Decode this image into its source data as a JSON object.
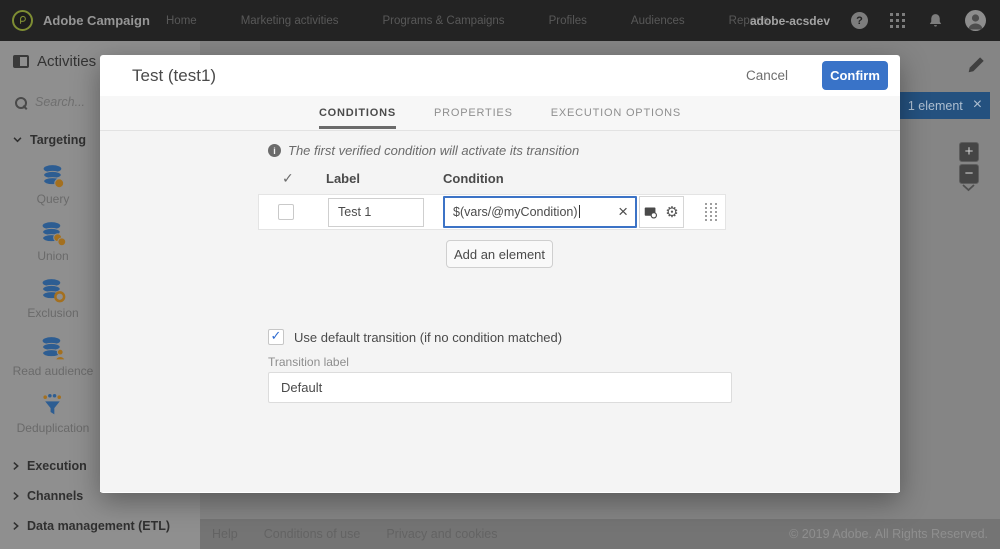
{
  "topbar": {
    "brand": "Adobe Campaign",
    "nav": [
      "Home",
      "Marketing activities",
      "Programs & Campaigns",
      "Profiles",
      "Audiences",
      "Reports"
    ],
    "account": "adobe-acsdev",
    "help_glyph": "?"
  },
  "sidebar": {
    "title": "Activities",
    "search_placeholder": "Search...",
    "targeting": {
      "label": "Targeting",
      "items": [
        "Query",
        "Union",
        "Exclusion",
        "Read audience",
        "Deduplication"
      ]
    },
    "collapsed_sections": [
      "Execution",
      "Channels",
      "Data management (ETL)"
    ]
  },
  "modal": {
    "title": "Test (test1)",
    "cancel": "Cancel",
    "confirm": "Confirm",
    "tabs": [
      "CONDITIONS",
      "PROPERTIES",
      "EXECUTION OPTIONS"
    ],
    "active_tab": "CONDITIONS",
    "info": "The first verified condition will activate its transition",
    "columns": {
      "check": "✓",
      "label": "Label",
      "condition": "Condition"
    },
    "row": {
      "label_value": "Test 1",
      "condition_value": "$(vars/@myCondition)",
      "clear_glyph": "×",
      "gear_glyph": "⚙"
    },
    "add_element": "Add an element",
    "use_default_label": "Use default transition (if no condition matched)",
    "use_default_checked": true,
    "check_glyph": "✓",
    "transition_label": "Transition label",
    "transition_value": "Default"
  },
  "workspace": {
    "badge_text": "1 element",
    "badge_close": "×",
    "zoom_in": "+",
    "zoom_out": "−"
  },
  "footer": {
    "links": [
      "Help",
      "Conditions of use",
      "Privacy and cookies"
    ],
    "copyright": "© 2019 Adobe. All Rights Reserved."
  },
  "colors": {
    "accent_blue": "#3973c8",
    "badge_blue": "#24517f",
    "icon_blue": "#2d5d92",
    "icon_orange": "#a4701f"
  }
}
